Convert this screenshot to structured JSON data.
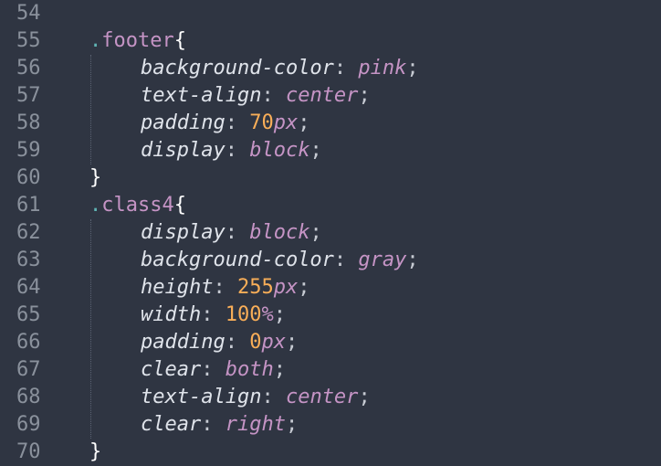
{
  "editor": {
    "lines": [
      {
        "num": "54",
        "indent": 0,
        "tokens": []
      },
      {
        "num": "55",
        "indent": 0,
        "tokens": [
          {
            "t": "dot",
            "v": "."
          },
          {
            "t": "sel",
            "v": "footer"
          },
          {
            "t": "brace",
            "v": "{"
          }
        ]
      },
      {
        "num": "56",
        "indent": 1,
        "tokens": [
          {
            "t": "prop",
            "v": "background-color"
          },
          {
            "t": "punc",
            "v": ": "
          },
          {
            "t": "val",
            "v": "pink"
          },
          {
            "t": "punc",
            "v": ";"
          }
        ]
      },
      {
        "num": "57",
        "indent": 1,
        "tokens": [
          {
            "t": "prop",
            "v": "text-align"
          },
          {
            "t": "punc",
            "v": ": "
          },
          {
            "t": "val",
            "v": "center"
          },
          {
            "t": "punc",
            "v": ";"
          }
        ]
      },
      {
        "num": "58",
        "indent": 1,
        "tokens": [
          {
            "t": "prop",
            "v": "padding"
          },
          {
            "t": "punc",
            "v": ": "
          },
          {
            "t": "num",
            "v": "70"
          },
          {
            "t": "unit",
            "v": "px"
          },
          {
            "t": "punc",
            "v": ";"
          }
        ]
      },
      {
        "num": "59",
        "indent": 1,
        "tokens": [
          {
            "t": "prop",
            "v": "display"
          },
          {
            "t": "punc",
            "v": ": "
          },
          {
            "t": "val",
            "v": "block"
          },
          {
            "t": "punc",
            "v": ";"
          }
        ]
      },
      {
        "num": "60",
        "indent": 0,
        "tokens": [
          {
            "t": "brace",
            "v": "}"
          }
        ]
      },
      {
        "num": "61",
        "indent": 0,
        "tokens": [
          {
            "t": "dot",
            "v": "."
          },
          {
            "t": "sel",
            "v": "class4"
          },
          {
            "t": "brace",
            "v": "{"
          }
        ]
      },
      {
        "num": "62",
        "indent": 1,
        "tokens": [
          {
            "t": "prop",
            "v": "display"
          },
          {
            "t": "punc",
            "v": ": "
          },
          {
            "t": "val",
            "v": "block"
          },
          {
            "t": "punc",
            "v": ";"
          }
        ]
      },
      {
        "num": "63",
        "indent": 1,
        "tokens": [
          {
            "t": "prop",
            "v": "background-color"
          },
          {
            "t": "punc",
            "v": ": "
          },
          {
            "t": "val",
            "v": "gray"
          },
          {
            "t": "punc",
            "v": ";"
          }
        ]
      },
      {
        "num": "64",
        "indent": 1,
        "tokens": [
          {
            "t": "prop",
            "v": "height"
          },
          {
            "t": "punc",
            "v": ": "
          },
          {
            "t": "num",
            "v": "255"
          },
          {
            "t": "unit",
            "v": "px"
          },
          {
            "t": "punc",
            "v": ";"
          }
        ]
      },
      {
        "num": "65",
        "indent": 1,
        "tokens": [
          {
            "t": "prop",
            "v": "width"
          },
          {
            "t": "punc",
            "v": ": "
          },
          {
            "t": "num",
            "v": "100"
          },
          {
            "t": "unit",
            "v": "%"
          },
          {
            "t": "punc",
            "v": ";"
          }
        ]
      },
      {
        "num": "66",
        "indent": 1,
        "tokens": [
          {
            "t": "prop",
            "v": "padding"
          },
          {
            "t": "punc",
            "v": ": "
          },
          {
            "t": "num",
            "v": "0"
          },
          {
            "t": "unit",
            "v": "px"
          },
          {
            "t": "punc",
            "v": ";"
          }
        ]
      },
      {
        "num": "67",
        "indent": 1,
        "tokens": [
          {
            "t": "prop",
            "v": "clear"
          },
          {
            "t": "punc",
            "v": ": "
          },
          {
            "t": "val",
            "v": "both"
          },
          {
            "t": "punc",
            "v": ";"
          }
        ]
      },
      {
        "num": "68",
        "indent": 1,
        "tokens": [
          {
            "t": "prop",
            "v": "text-align"
          },
          {
            "t": "punc",
            "v": ": "
          },
          {
            "t": "val",
            "v": "center"
          },
          {
            "t": "punc",
            "v": ";"
          }
        ]
      },
      {
        "num": "69",
        "indent": 1,
        "tokens": [
          {
            "t": "prop",
            "v": "clear"
          },
          {
            "t": "punc",
            "v": ": "
          },
          {
            "t": "val",
            "v": "right"
          },
          {
            "t": "punc",
            "v": ";"
          }
        ]
      },
      {
        "num": "70",
        "indent": 0,
        "tokens": [
          {
            "t": "brace",
            "v": "}"
          }
        ]
      }
    ]
  },
  "theme": {
    "background": "#2f3542",
    "line_number": "#8a919c",
    "selector_dot": "#5fb3b3",
    "selector": "#c594c5",
    "brace": "#ffffff",
    "property": "#dfe3ea",
    "value": "#c594c5",
    "number": "#f9ae58"
  }
}
